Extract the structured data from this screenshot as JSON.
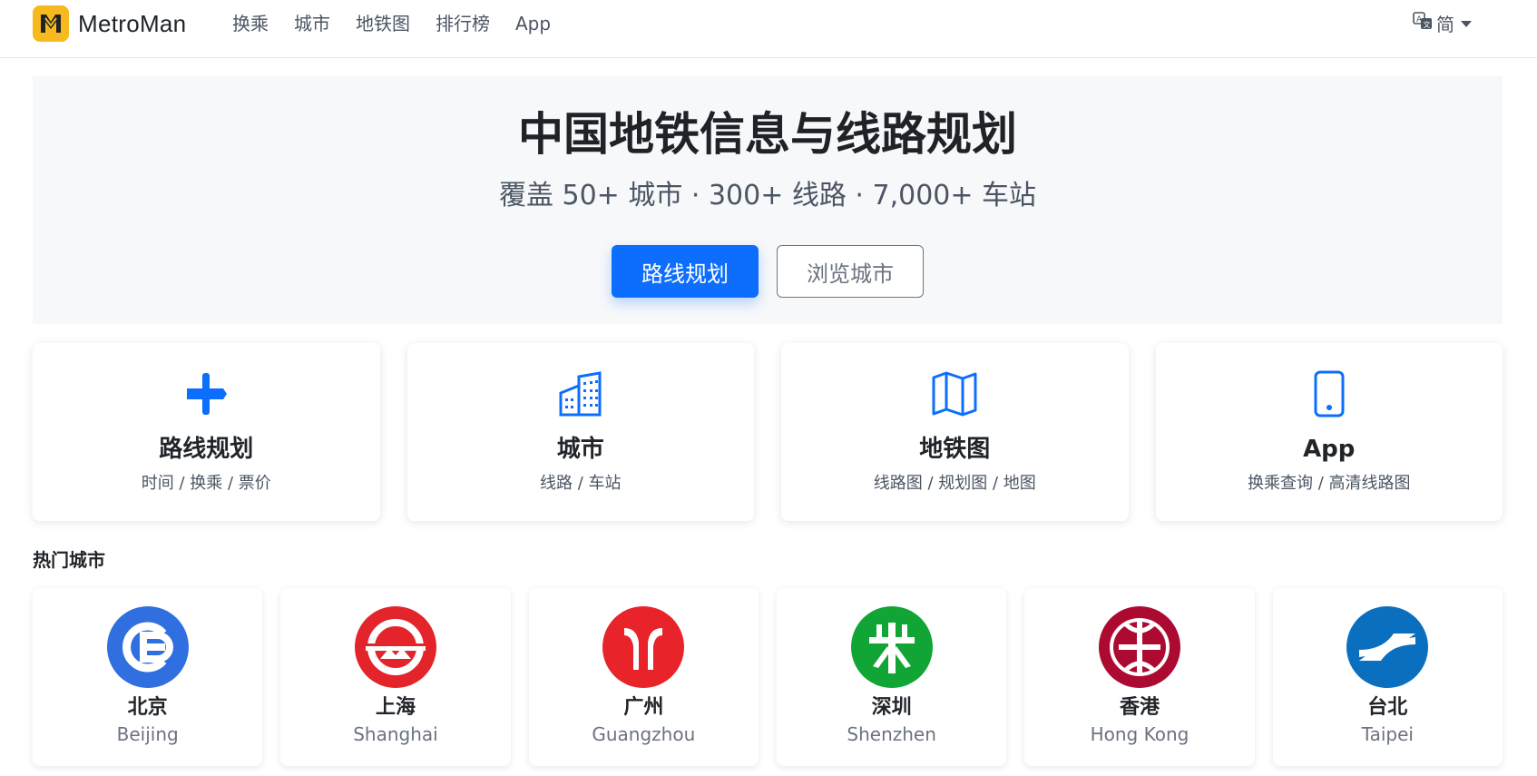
{
  "brand": {
    "name": "MetroMan",
    "logo_color": "#f7b91d"
  },
  "nav": {
    "links": [
      "换乘",
      "城市",
      "地铁图",
      "排行榜",
      "App"
    ]
  },
  "language": {
    "label": "简",
    "icon": "translate-icon"
  },
  "hero": {
    "title": "中国地铁信息与线路规划",
    "subtitle": "覆盖 50+ 城市 · 300+ 线路 · 7,000+ 车站",
    "primary_button": "路线规划",
    "secondary_button": "浏览城市"
  },
  "features": [
    {
      "icon": "signpost-icon",
      "title": "路线规划",
      "desc": "时间 / 换乘 / 票价"
    },
    {
      "icon": "buildings-icon",
      "title": "城市",
      "desc": "线路 / 车站"
    },
    {
      "icon": "map-icon",
      "title": "地铁图",
      "desc": "线路图 / 规划图 / 地图"
    },
    {
      "icon": "phone-icon",
      "title": "App",
      "desc": "换乘查询 / 高清线路图"
    }
  ],
  "hot_cities": {
    "title": "热门城市",
    "items": [
      {
        "name": "北京",
        "en": "Beijing",
        "color": "#2f6fe0",
        "icon": "beijing-subway-logo"
      },
      {
        "name": "上海",
        "en": "Shanghai",
        "color": "#e3242b",
        "icon": "shanghai-metro-logo"
      },
      {
        "name": "广州",
        "en": "Guangzhou",
        "color": "#e8232a",
        "icon": "guangzhou-metro-logo"
      },
      {
        "name": "深圳",
        "en": "Shenzhen",
        "color": "#10a534",
        "icon": "shenzhen-metro-logo"
      },
      {
        "name": "香港",
        "en": "Hong Kong",
        "color": "#ad0a32",
        "icon": "hongkong-mtr-logo"
      },
      {
        "name": "台北",
        "en": "Taipei",
        "color": "#0b6fc0",
        "icon": "taipei-metro-logo"
      }
    ]
  },
  "colors": {
    "accent": "#0d6efd"
  }
}
